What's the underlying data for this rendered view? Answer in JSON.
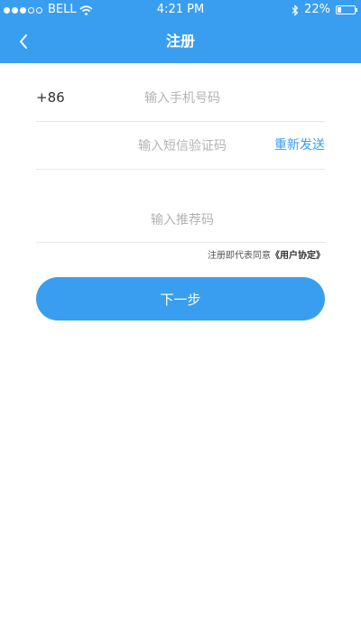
{
  "status_bar": {
    "carrier": "BELL",
    "time": "4:21 PM",
    "battery_text": "22%",
    "battery_level": 0.22
  },
  "nav": {
    "title": "注册"
  },
  "form": {
    "country_code": "+86",
    "phone_placeholder": "输入手机号码",
    "code_placeholder": "输入短信验证码",
    "resend_label": "重新发送",
    "referral_placeholder": "输入推荐码"
  },
  "agreement": {
    "prefix": "注册即代表同意",
    "link": "《用户协定》"
  },
  "actions": {
    "next_label": "下一步"
  },
  "colors": {
    "primary": "#3a9ef0",
    "divider": "#e6e6e6",
    "placeholder": "#b3b3b3"
  },
  "icons": {
    "back": "chevron-left-icon",
    "wifi": "wifi-icon",
    "bluetooth": "bluetooth-icon",
    "battery": "battery-icon"
  }
}
